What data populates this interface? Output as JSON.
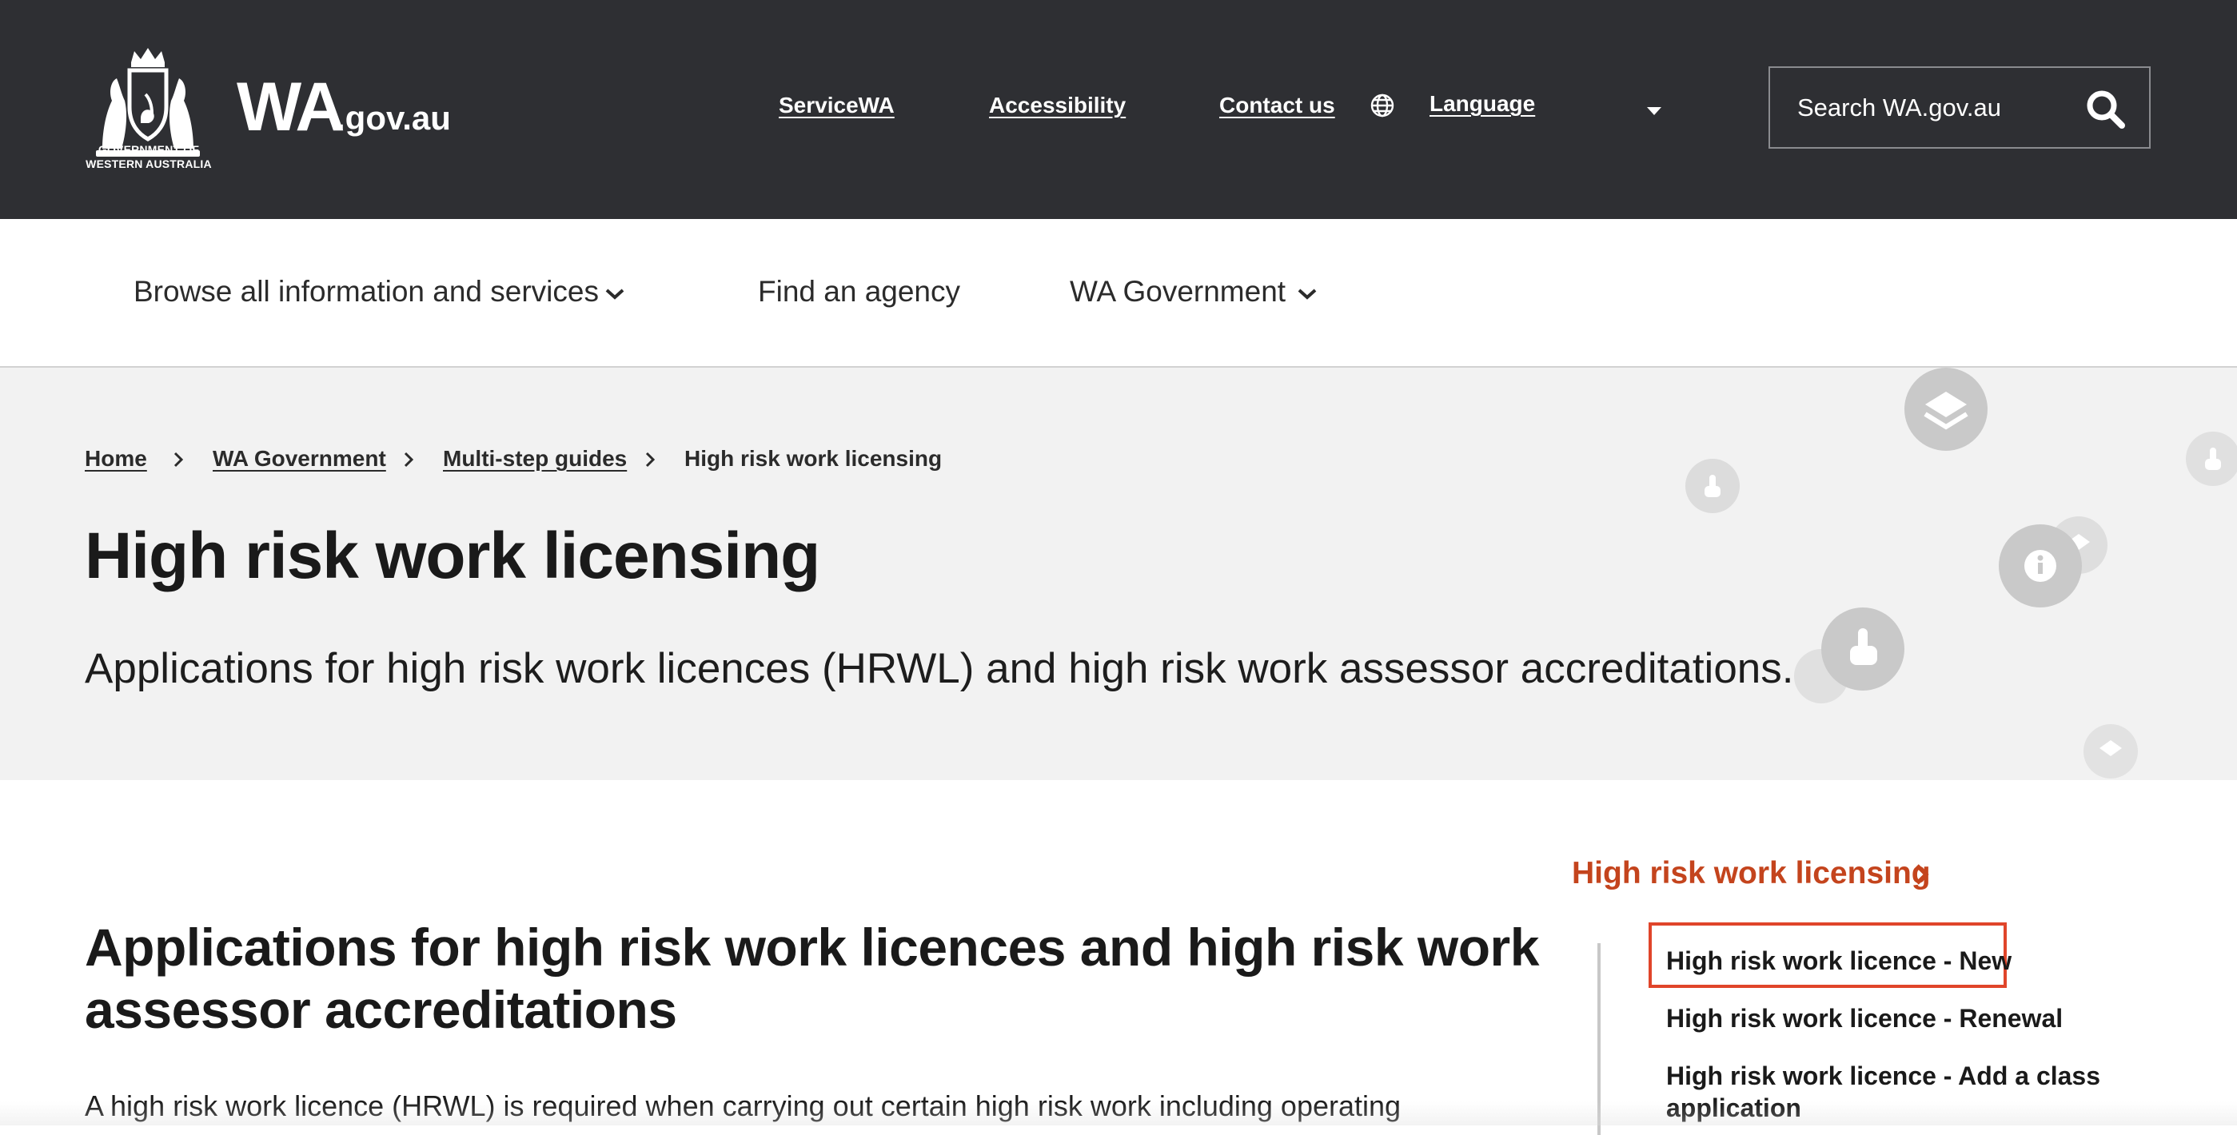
{
  "header": {
    "crest_caption_line1": "GOVERNMENT OF",
    "crest_caption_line2": "WESTERN AUSTRALIA",
    "logo_main": "WA",
    "logo_suffix": ".gov.au",
    "links": {
      "servicewa": "ServiceWA",
      "accessibility": "Accessibility",
      "contact": "Contact us",
      "language": "Language"
    },
    "search": {
      "placeholder": "Search WA.gov.au"
    }
  },
  "main_nav": {
    "browse": "Browse all information and services",
    "find_agency": "Find an agency",
    "wa_government": "WA Government"
  },
  "breadcrumb": {
    "home": "Home",
    "wa_government": "WA Government",
    "guides": "Multi-step guides",
    "current": "High risk work licensing"
  },
  "hero": {
    "title": "High risk work licensing",
    "subtitle": "Applications for high risk work licences (HRWL) and high risk work assessor accreditations."
  },
  "content": {
    "heading": "Applications for high risk work licences and high risk work assessor accreditations",
    "paragraph": "A high risk work licence (HRWL) is required when carrying out certain high risk work including operating"
  },
  "side_nav": {
    "title": "High risk work licensing",
    "items": [
      "High risk work licence - New",
      "High risk work licence - Renewal",
      "High risk work licence - Add a class application"
    ]
  },
  "colors": {
    "topbar": "#2e2f33",
    "accent": "#c4441d",
    "highlight_border": "#e0452a",
    "hero_bg": "#f2f2f2"
  }
}
